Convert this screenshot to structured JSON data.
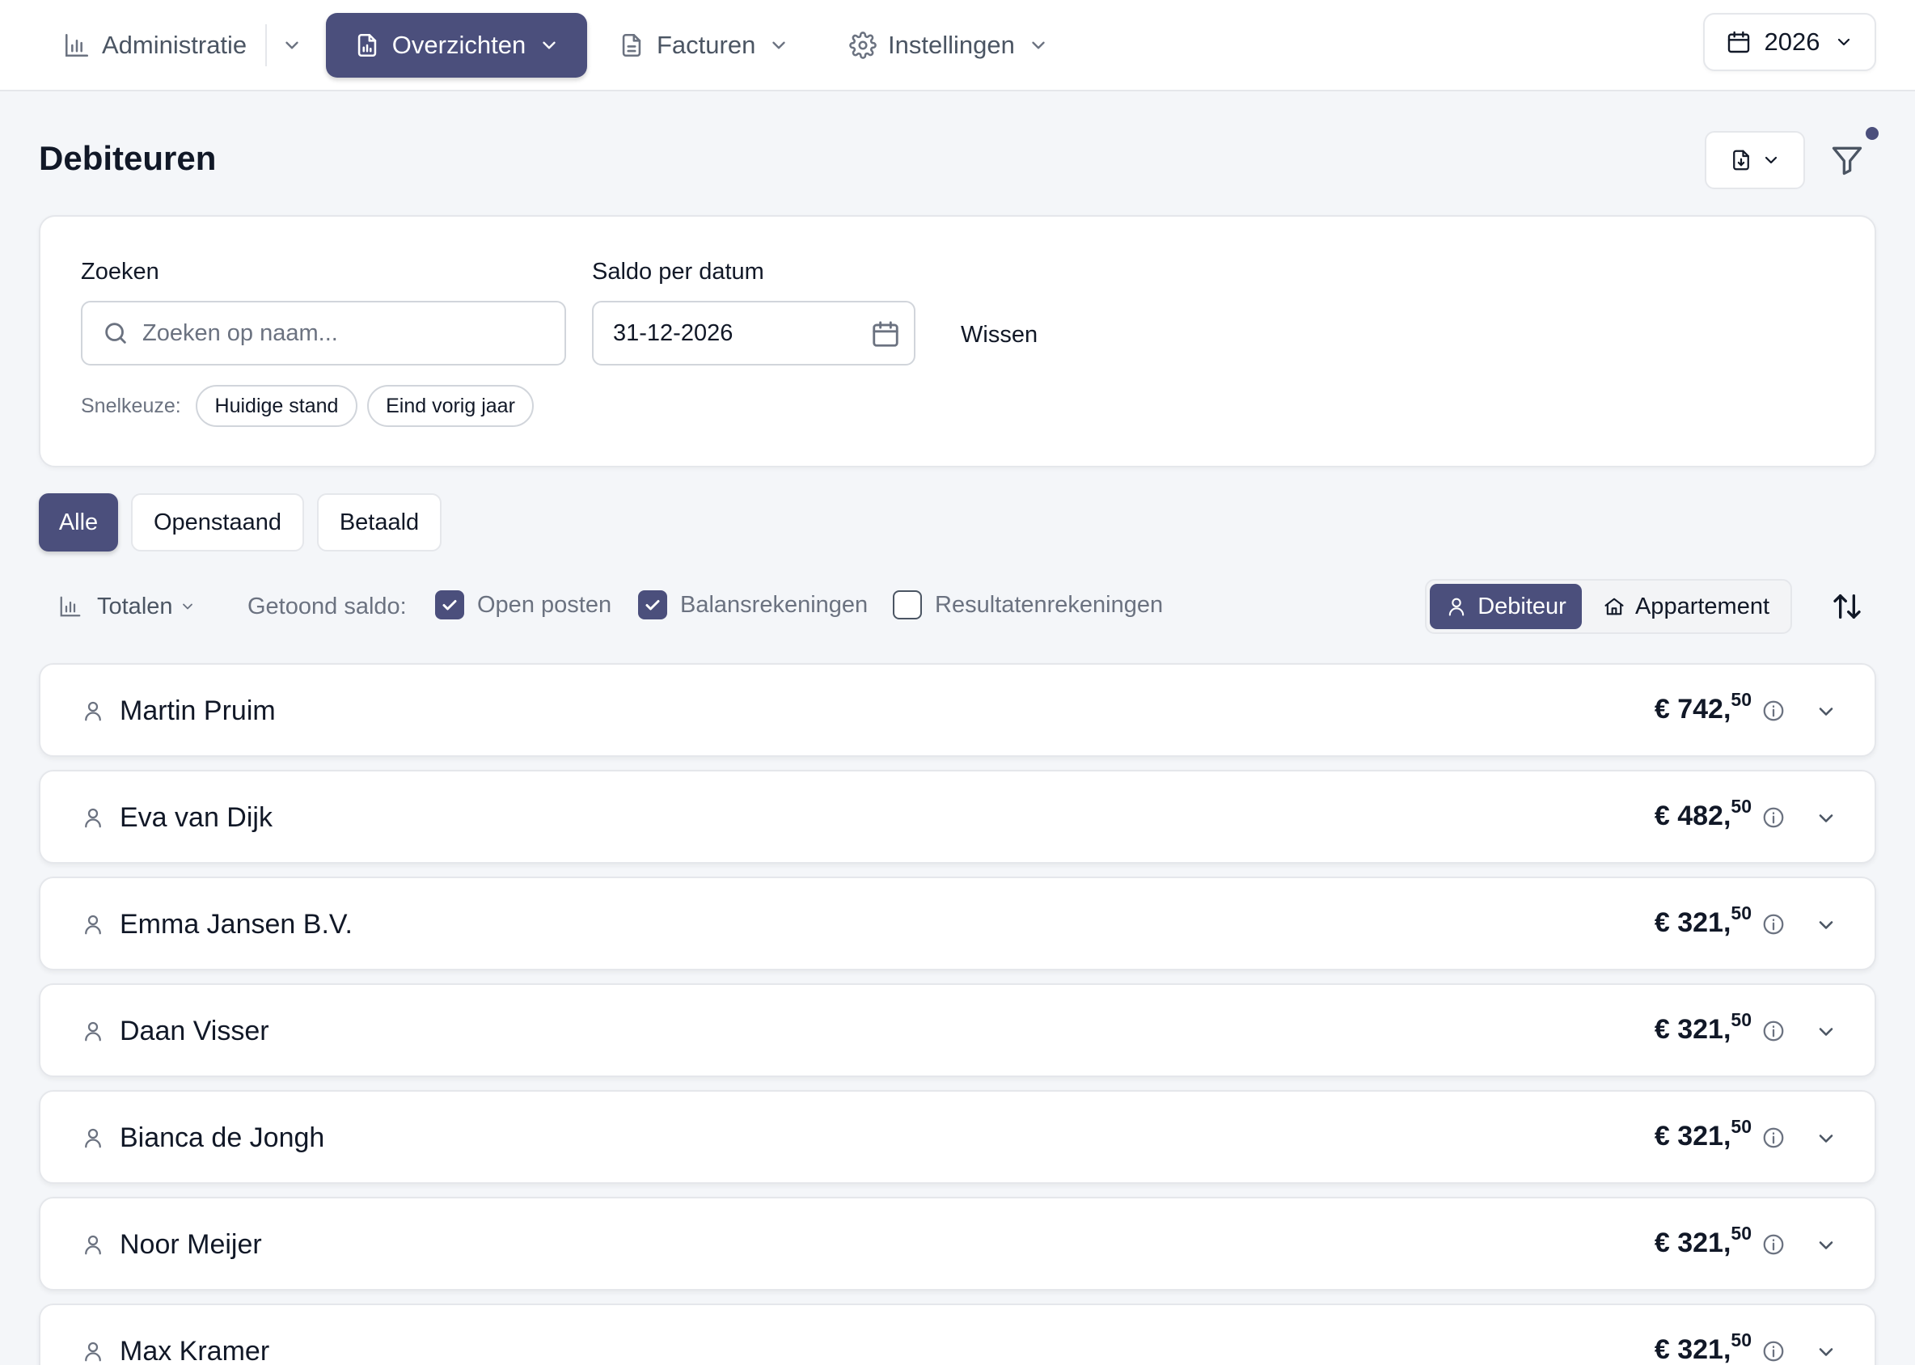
{
  "nav": {
    "items": [
      {
        "label": "Administratie",
        "icon": "bar-chart-icon"
      },
      {
        "label": "Overzichten",
        "icon": "document-chart-icon"
      },
      {
        "label": "Facturen",
        "icon": "document-text-icon"
      },
      {
        "label": "Instellingen",
        "icon": "gear-icon"
      }
    ],
    "active_item": "Overzichten",
    "year": "2026"
  },
  "page": {
    "title": "Debiteuren"
  },
  "filters": {
    "search_label": "Zoeken",
    "search_placeholder": "Zoeken op naam...",
    "search_value": "",
    "date_label": "Saldo per datum",
    "date_value": "31-12-2026",
    "clear_label": "Wissen",
    "quick_label": "Snelkeuze:",
    "quick_options": [
      "Huidige stand",
      "Eind vorig jaar"
    ]
  },
  "tabs": {
    "items": [
      "Alle",
      "Openstaand",
      "Betaald"
    ],
    "active": "Alle"
  },
  "options": {
    "totals_label": "Totalen",
    "saldo_label": "Getoond saldo:",
    "checkboxes": [
      {
        "label": "Open posten",
        "checked": true
      },
      {
        "label": "Balansrekeningen",
        "checked": true
      },
      {
        "label": "Resultatenrekeningen",
        "checked": false
      }
    ],
    "group_by": [
      {
        "label": "Debiteur",
        "icon": "user-icon",
        "active": true
      },
      {
        "label": "Appartement",
        "icon": "home-icon",
        "active": false
      }
    ]
  },
  "accent_color": "#4b4f7c",
  "debtors": [
    {
      "name": "Martin Pruim",
      "amount_main": "€ 742,",
      "amount_cents": "50"
    },
    {
      "name": "Eva van Dijk",
      "amount_main": "€ 482,",
      "amount_cents": "50"
    },
    {
      "name": "Emma Jansen B.V.",
      "amount_main": "€ 321,",
      "amount_cents": "50"
    },
    {
      "name": "Daan Visser",
      "amount_main": "€ 321,",
      "amount_cents": "50"
    },
    {
      "name": "Bianca de Jongh",
      "amount_main": "€ 321,",
      "amount_cents": "50"
    },
    {
      "name": "Noor Meijer",
      "amount_main": "€ 321,",
      "amount_cents": "50"
    },
    {
      "name": "Max Kramer",
      "amount_main": "€ 321,",
      "amount_cents": "50"
    }
  ]
}
